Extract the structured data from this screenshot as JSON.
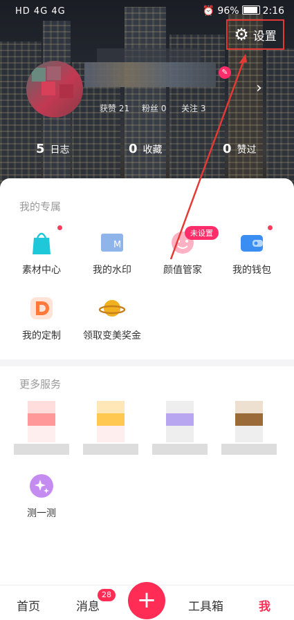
{
  "status_bar": {
    "left": "HD 4G 4G",
    "battery": "96%",
    "time": "2:16"
  },
  "header": {
    "settings_label": "设置",
    "settings_icon": "gear-icon"
  },
  "profile": {
    "mini_stats": [
      "获赞 21",
      "粉丝 0",
      "关注 3"
    ],
    "stats": [
      {
        "value": "5",
        "label": "日志"
      },
      {
        "value": "0",
        "label": "收藏"
      },
      {
        "value": "0",
        "label": "赞过"
      }
    ]
  },
  "exclusive": {
    "title": "我的专属",
    "items": [
      {
        "label": "素材中心",
        "icon": "bag-icon",
        "color": "#1ec8d8"
      },
      {
        "label": "我的水印",
        "icon": "watermark-icon",
        "color": "#8fb4ea"
      },
      {
        "label": "颜值管家",
        "icon": "face-icon",
        "color": "#ffb1c4"
      },
      {
        "label": "我的钱包",
        "icon": "wallet-icon",
        "color": "#3a8ef2"
      },
      {
        "label": "我的定制",
        "icon": "custom-d-icon",
        "color": "#ff7a3a"
      },
      {
        "label": "领取变美奖金",
        "icon": "planet-icon",
        "color": "#f0b020"
      }
    ],
    "unset_tag": "未设置"
  },
  "more": {
    "title": "更多服务",
    "quiz_label": "测一测",
    "quiz_icon": "sparkle-icon"
  },
  "tabs": {
    "home": "首页",
    "messages": "消息",
    "message_count": "28",
    "plus": "+",
    "toolbox": "工具箱",
    "me": "我"
  },
  "colors": {
    "accent": "#ff2d55",
    "highlight_box": "#e53935"
  }
}
